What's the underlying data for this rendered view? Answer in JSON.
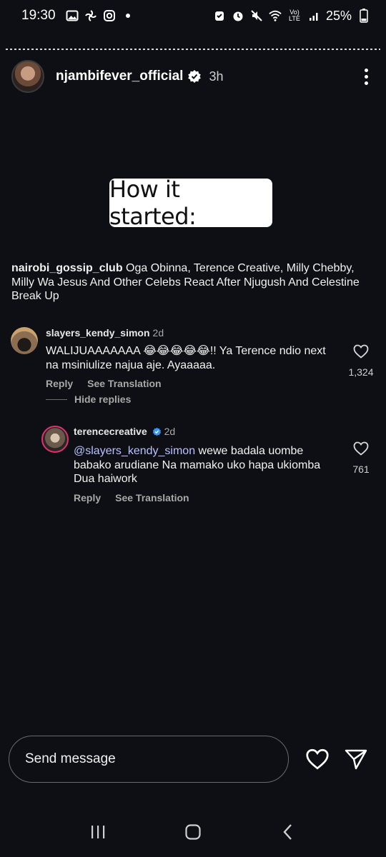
{
  "status": {
    "time": "19:30",
    "battery": "25%",
    "left_icons": [
      "image-icon",
      "pinwheel-icon",
      "instagram-icon",
      "dot-icon"
    ],
    "right_icons": [
      "alarm-icon",
      "clock-icon",
      "mute-icon",
      "wifi-icon",
      "volte-icon",
      "signal-icon",
      "battery-icon"
    ],
    "volte_label": "Vo) LTE"
  },
  "story": {
    "username": "njambifever_official",
    "time_ago": "3h",
    "sticker_text": "How it started:"
  },
  "caption": {
    "user": "nairobi_gossip_club",
    "text": " Oga Obinna, Terence Creative, Milly Chebby, Milly Wa Jesus And Other Celebs React After Njugush And Celestine Break Up"
  },
  "comments": [
    {
      "user": "slayers_kendy_simon",
      "when": "2d",
      "text": "WALIJUAAAAAAA 😂😂😂😂😂!! Ya Terence ndio next na msiniulize najua aje. Ayaaaaa.",
      "reply_label": "Reply",
      "translate_label": "See Translation",
      "likes": "1,324"
    },
    {
      "user": "terencecreative",
      "when": "2d",
      "mention": "@slayers_kendy_simon",
      "text": " wewe badala uombe babako arudiane Na mamako uko hapa ukiomba Dua haiwork",
      "reply_label": "Reply",
      "translate_label": "See Translation",
      "likes": "761"
    }
  ],
  "hide_replies": "Hide replies",
  "composer": {
    "placeholder": "Send message"
  },
  "colors": {
    "background": "#0e0f14",
    "mention": "#b9c1ff",
    "verified": "#3897f0"
  }
}
